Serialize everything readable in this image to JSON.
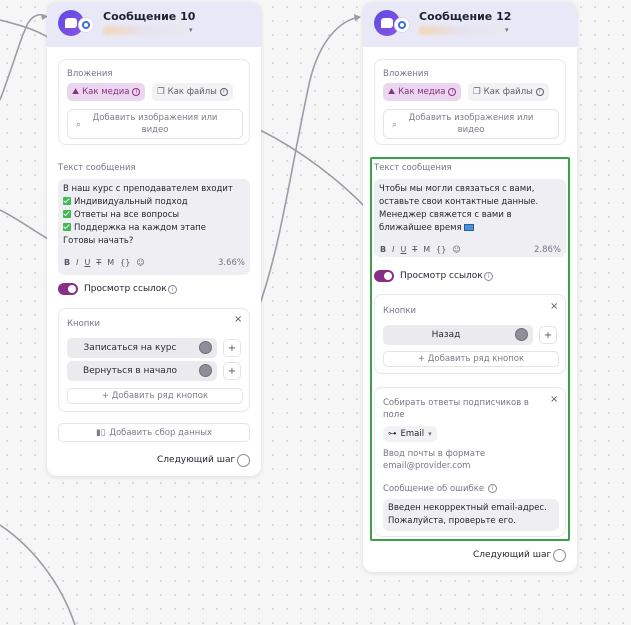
{
  "cards": [
    {
      "title": "Сообщение 10",
      "attachments_label": "Вложения",
      "media_label": "Как медиа",
      "files_label": "Как файлы",
      "add_media_line1": "Добавить изображения или",
      "add_media_line2": "видео",
      "text_label": "Текст сообщения",
      "text_lines": [
        "В наш курс с преподавателем входит",
        "Индивидуальный подход",
        "Ответы на все вопросы",
        "Поддержка на каждом этапе",
        "Готовы начать?"
      ],
      "format_percent": "3.66%",
      "link_preview_label": "Просмотр ссылок",
      "buttons_label": "Кнопки",
      "buttons": [
        "Записаться на курс",
        "Вернуться в начало"
      ],
      "add_button_row": "+ Добавить ряд кнопок",
      "add_data_collection": "Добавить сбор данных",
      "next_step": "Следующий шаг"
    },
    {
      "title": "Сообщение 12",
      "attachments_label": "Вложения",
      "media_label": "Как медиа",
      "files_label": "Как файлы",
      "add_media_line1": "Добавить изображения или",
      "add_media_line2": "видео",
      "text_label": "Текст сообщения",
      "text_lines": [
        "Чтобы мы могли связаться с вами,",
        "оставьте свои контактные данные.",
        "Менеджер свяжется с вами в",
        "ближайшее время"
      ],
      "format_percent": "2.86%",
      "link_preview_label": "Просмотр ссылок",
      "buttons_label": "Кнопки",
      "buttons": [
        "Назад"
      ],
      "add_button_row": "+ Добавить ряд кнопок",
      "collect_label_line1": "Собирать ответы подписчиков в",
      "collect_label_line2": "поле",
      "collect_field": "Email",
      "collect_hint_line1": "Ввод почты в формате",
      "collect_hint_line2": "email@provider.com",
      "error_label": "Сообщение об ошибке",
      "error_line1": "Введен некорректный email-адрес.",
      "error_line2": "Пожалуйста, проверьте его.",
      "next_step": "Следующий шаг"
    }
  ],
  "toolbar_glyphs": [
    "B",
    "I",
    "U",
    "T",
    "M",
    "{}",
    "☺"
  ],
  "icons": {
    "toggle_color": "#872f86",
    "highlight_color": "#3aa14a",
    "checkbox_color": "#3fb950"
  }
}
